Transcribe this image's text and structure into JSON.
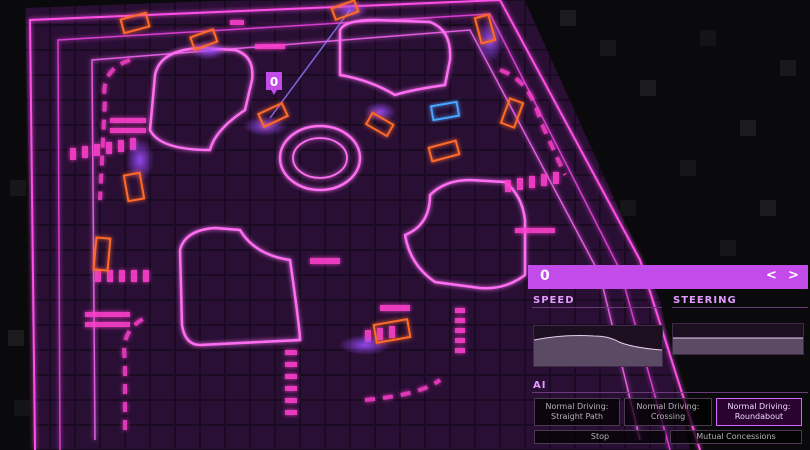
{
  "tracked_car_marker": "0",
  "panel": {
    "car_id": "0",
    "prev_label": "<",
    "next_label": ">",
    "speed_label": "SPEED",
    "steering_label": "STEERING",
    "ai_label": "AI"
  },
  "ai_buttons": [
    {
      "label": "Normal Driving:\nStraight Path",
      "active": false
    },
    {
      "label": "Normal Driving:\nCrossing",
      "active": false
    },
    {
      "label": "Normal Driving:\nRoundabout",
      "active": true
    },
    {
      "label": "Stop",
      "active": false
    },
    {
      "label": "Mutual Concessions",
      "active": false
    }
  ],
  "colors": {
    "background": "#000000",
    "grid": "#3b1846",
    "road_neon": "#ff4fe8",
    "header": "#c24be9",
    "car_orange": "#ff6a2a",
    "car_blue": "#4aa6ff",
    "active_border": "#d568ff"
  }
}
